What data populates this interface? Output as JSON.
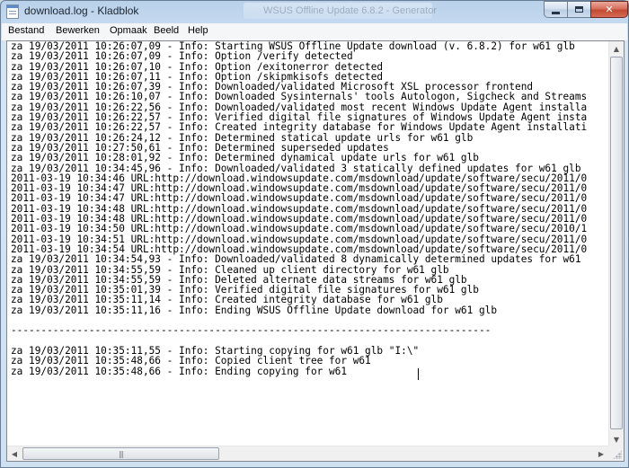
{
  "window": {
    "title": "download.log - Kladblok",
    "background_title": "WSUS Offline Update 6.8.2 - Generator"
  },
  "menu": [
    {
      "label": "Bestand"
    },
    {
      "label": "Bewerken"
    },
    {
      "label": "Opmaak"
    },
    {
      "label": "Beeld"
    },
    {
      "label": "Help"
    }
  ],
  "editor": {
    "lines": [
      "za 19/03/2011 10:26:07,09 - Info: Starting WSUS Offline Update download (v. 6.8.2) for w61 glb",
      "za 19/03/2011 10:26:07,09 - Info: Option /verify detected",
      "za 19/03/2011 10:26:07,10 - Info: Option /exitonerror detected",
      "za 19/03/2011 10:26:07,11 - Info: Option /skipmkisofs detected",
      "za 19/03/2011 10:26:07,39 - Info: Downloaded/validated Microsoft XSL processor frontend",
      "za 19/03/2011 10:26:10,07 - Info: Downloaded Sysinternals' tools Autologon, Sigcheck and Streams",
      "za 19/03/2011 10:26:22,56 - Info: Downloaded/validated most recent Windows Update Agent installa",
      "za 19/03/2011 10:26:22,57 - Info: Verified digital file signatures of Windows Update Agent insta",
      "za 19/03/2011 10:26:22,57 - Info: Created integrity database for Windows Update Agent installati",
      "za 19/03/2011 10:26:24,12 - Info: Determined statical update urls for w61 glb",
      "za 19/03/2011 10:27:50,61 - Info: Determined superseded updates",
      "za 19/03/2011 10:28:01,92 - Info: Determined dynamical update urls for w61 glb",
      "za 19/03/2011 10:34:45,96 - Info: Downloaded/validated 3 statically defined updates for w61 glb",
      "2011-03-19 10:34:46 URL:http://download.windowsupdate.com/msdownload/update/software/secu/2011/0",
      "2011-03-19 10:34:47 URL:http://download.windowsupdate.com/msdownload/update/software/secu/2011/0",
      "2011-03-19 10:34:47 URL:http://download.windowsupdate.com/msdownload/update/software/secu/2011/0",
      "2011-03-19 10:34:48 URL:http://download.windowsupdate.com/msdownload/update/software/secu/2011/0",
      "2011-03-19 10:34:48 URL:http://download.windowsupdate.com/msdownload/update/software/secu/2011/0",
      "2011-03-19 10:34:50 URL:http://download.windowsupdate.com/msdownload/update/software/secu/2010/1",
      "2011-03-19 10:34:51 URL:http://download.windowsupdate.com/msdownload/update/software/secu/2011/0",
      "2011-03-19 10:34:54 URL:http://download.windowsupdate.com/msdownload/update/software/secu/2011/0",
      "za 19/03/2011 10:34:54,93 - Info: Downloaded/validated 8 dynamically determined updates for w61",
      "za 19/03/2011 10:34:55,59 - Info: Cleaned up client directory for w61 glb",
      "za 19/03/2011 10:34:55,59 - Info: Deleted alternate data streams for w61 glb",
      "za 19/03/2011 10:35:01,39 - Info: Verified digital file signatures for w61 glb",
      "za 19/03/2011 10:35:11,14 - Info: Created integrity database for w61 glb",
      "za 19/03/2011 10:35:11,16 - Info: Ending WSUS Offline Update download for w61 glb",
      "",
      "--------------------------------------------------------------------------------",
      "",
      "za 19/03/2011 10:35:11,55 - Info: Starting copying for w61 glb \"I:\\\"",
      "za 19/03/2011 10:35:48,66 - Info: Copied client tree for w61",
      "za 19/03/2011 10:35:48,66 - Info: Ending copying for w61"
    ]
  },
  "icons": {
    "app": "notepad-icon",
    "minimize": "minimize-icon",
    "maximize": "maximize-icon",
    "close": "close-icon",
    "scroll_up": "chevron-up-icon",
    "scroll_down": "chevron-down-icon",
    "scroll_left": "chevron-left-icon",
    "scroll_right": "chevron-right-icon"
  }
}
